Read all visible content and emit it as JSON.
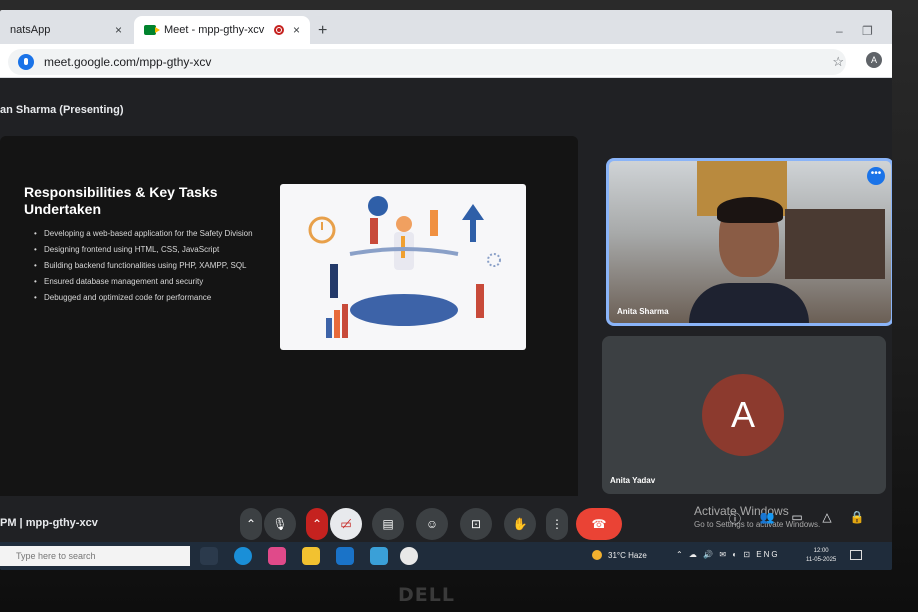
{
  "browser": {
    "tabs": [
      {
        "label": "natsApp",
        "close": "×"
      },
      {
        "label": "Meet - mpp-gthy-xcv",
        "close": "×"
      }
    ],
    "new_tab": "+",
    "url": "meet.google.com/mpp-gthy-xcv",
    "profile_initial": "A",
    "window_controls": [
      "–",
      "❐",
      "✕"
    ]
  },
  "meet": {
    "presenter_label": "an Sharma (Presenting)",
    "slide": {
      "title": "Responsibilities & Key Tasks Undertaken",
      "bullets": [
        "Developing  a web-based application for the Safety Division",
        "Designing frontend using HTML, CSS, JavaScript",
        "Building backend functionalities using PHP, XAMPP, SQL",
        "Ensured database management and security",
        "Debugged and optimized code for performance"
      ]
    },
    "participants": [
      {
        "name": "Anita Sharma",
        "state": "video"
      },
      {
        "name": "Anita Yadav",
        "avatar_initial": "A",
        "avatar_color": "#8c3a2e"
      }
    ],
    "meeting_info": "PM  |  mpp-gthy-xcv",
    "controls": {
      "mic": "mic-icon",
      "camera_off": "camera-off-icon",
      "captions": "captions-icon",
      "emoji": "emoji-icon",
      "present": "present-screen-icon",
      "raise_hand": "raise-hand-icon",
      "more": "more-options-icon",
      "end_call": "end-call-icon"
    }
  },
  "windows": {
    "activate_title": "Activate Windows",
    "activate_sub": "Go to Settings to activate Windows.",
    "search_placeholder": "Type here to search",
    "weather": "31°C  Haze",
    "lang": "ENG",
    "time": "12:00",
    "date": "11-05-2025"
  },
  "monitor_brand": "DELL",
  "colors": {
    "accent": "#8ab4f8",
    "end_call": "#ea4335",
    "cam_off": "#c5221f"
  }
}
